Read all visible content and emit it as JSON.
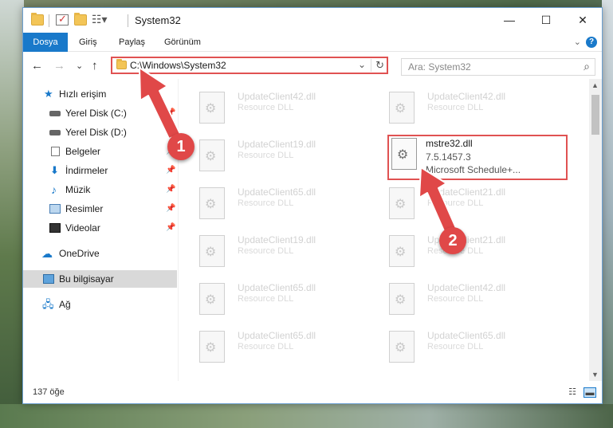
{
  "window": {
    "title": "System32",
    "controls": {
      "minimize": "—",
      "maximize": "☐",
      "close": "✕"
    }
  },
  "ribbon": {
    "tabs": [
      "Dosya",
      "Giriş",
      "Paylaş",
      "Görünüm"
    ],
    "help": "?"
  },
  "navigation": {
    "back_icon": "←",
    "forward_icon": "→",
    "recent_icon": "⌄",
    "up_icon": "↑",
    "address": "C:\\Windows\\System32",
    "address_dropdown": "⌄",
    "refresh_icon": "↻",
    "search_placeholder": "Ara: System32",
    "search_icon": "⌕"
  },
  "sidebar": {
    "items": [
      {
        "label": "Hızlı erişim",
        "icon": "star-icon",
        "pinned": false
      },
      {
        "label": "Yerel Disk (C:)",
        "icon": "disk-icon",
        "pinned": true
      },
      {
        "label": "Yerel Disk (D:)",
        "icon": "disk-icon",
        "pinned": true
      },
      {
        "label": "Belgeler",
        "icon": "documents-icon",
        "pinned": true
      },
      {
        "label": "İndirmeler",
        "icon": "downloads-icon",
        "pinned": true
      },
      {
        "label": "Müzik",
        "icon": "music-icon",
        "pinned": true
      },
      {
        "label": "Resimler",
        "icon": "pictures-icon",
        "pinned": true
      },
      {
        "label": "Videolar",
        "icon": "videos-icon",
        "pinned": true
      },
      {
        "label": "OneDrive",
        "icon": "onedrive-icon",
        "pinned": false
      },
      {
        "label": "Bu bilgisayar",
        "icon": "this-pc-icon",
        "pinned": false,
        "selected": true
      },
      {
        "label": "Ağ",
        "icon": "network-icon",
        "pinned": false
      }
    ]
  },
  "files": [
    {
      "name": "UpdateClient42.dll",
      "desc": "Resource DLL"
    },
    {
      "name": "UpdateClient42.dll",
      "desc": "Resource DLL"
    },
    {
      "name": "UpdateClient19.dll",
      "desc": "Resource DLL"
    },
    {
      "name": "mstre32.dll",
      "desc": "7.5.1457.3",
      "company": "Microsoft Schedule+...",
      "highlighted": true
    },
    {
      "name": "UpdateClient65.dll",
      "desc": "Resource DLL"
    },
    {
      "name": "UpdateClient21.dll",
      "desc": "Resource DLL"
    },
    {
      "name": "UpdateClient19.dll",
      "desc": "Resource DLL"
    },
    {
      "name": "UpdateClient21.dll",
      "desc": "Resource DLL"
    },
    {
      "name": "UpdateClient65.dll",
      "desc": "Resource DLL"
    },
    {
      "name": "UpdateClient42.dll",
      "desc": "Resource DLL"
    },
    {
      "name": "UpdateClient65.dll",
      "desc": "Resource DLL"
    },
    {
      "name": "UpdateClient65.dll",
      "desc": "Resource DLL"
    }
  ],
  "status": {
    "item_count": "137 öğe"
  },
  "annotations": {
    "badge1": "1",
    "badge2": "2",
    "color": "#e04848"
  },
  "colors": {
    "accent": "#1979ca",
    "highlight_border": "#e05252"
  }
}
